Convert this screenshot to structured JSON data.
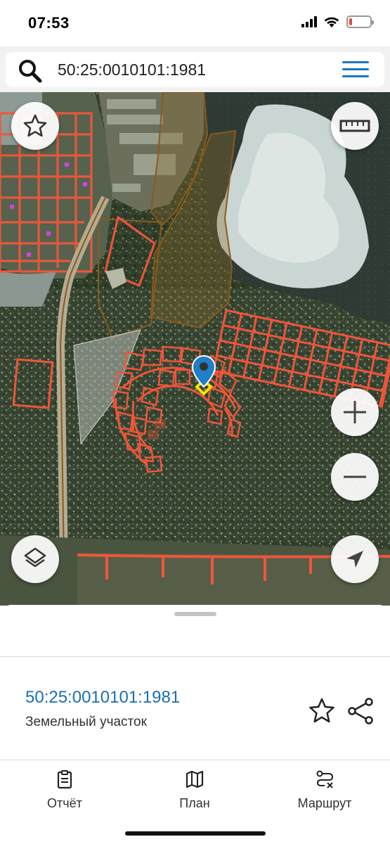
{
  "status_bar": {
    "time": "07:53",
    "icons": [
      "signal-icon",
      "wifi-icon",
      "battery-icon"
    ],
    "battery_level": 0.15,
    "battery_color": "#e8473f"
  },
  "search": {
    "value": "50:25:0010101:1981",
    "icon": "search-icon",
    "menu_icon": "menu-icon",
    "accent": "#1a78c2"
  },
  "map": {
    "buttons": [
      "favorite-icon",
      "ruler-icon",
      "zoom-in-icon",
      "zoom-out-icon",
      "layers-icon",
      "location-arrow-icon"
    ],
    "parcel_outline_color": "#f0553a",
    "selected_marker_color": "#1f7fc8",
    "selected_parcel_color": "#f5e400"
  },
  "parcel": {
    "id": "50:25:0010101:1981",
    "type": "Земельный участок",
    "id_color": "#1a6fb0"
  },
  "tabs": [
    {
      "label": "Отчёт",
      "icon": "report-icon"
    },
    {
      "label": "План",
      "icon": "map-plan-icon"
    },
    {
      "label": "Маршрут",
      "icon": "route-icon"
    }
  ]
}
